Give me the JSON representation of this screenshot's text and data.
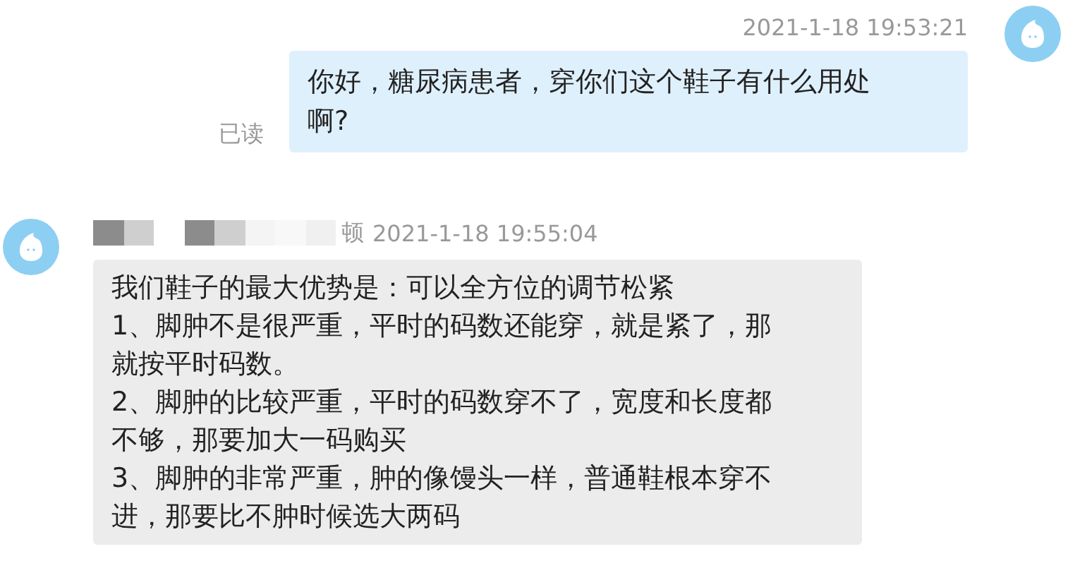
{
  "messages": [
    {
      "kind": "outgoing",
      "time": "2021-1-18 19:53:21",
      "text": "你好，糖尿病患者，穿你们这个鞋子有什么用处啊?",
      "read_label": "已读"
    },
    {
      "kind": "incoming",
      "sender_visible": "顿",
      "sender_redacted": true,
      "time": "2021-1-18 19:55:04",
      "lines": [
        "我们鞋子的最大优势是：可以全方位的调节松紧",
        "1、脚肿不是很严重，平时的码数还能穿，就是紧了，那就按平时码数。",
        "2、脚肿的比较严重，平时的码数穿不了，宽度和长度都不够，那要加大一码购买",
        "3、脚肿的非常严重，肿的像馒头一样，普通鞋根本穿不进，那要比不肿时候选大两码"
      ]
    }
  ]
}
